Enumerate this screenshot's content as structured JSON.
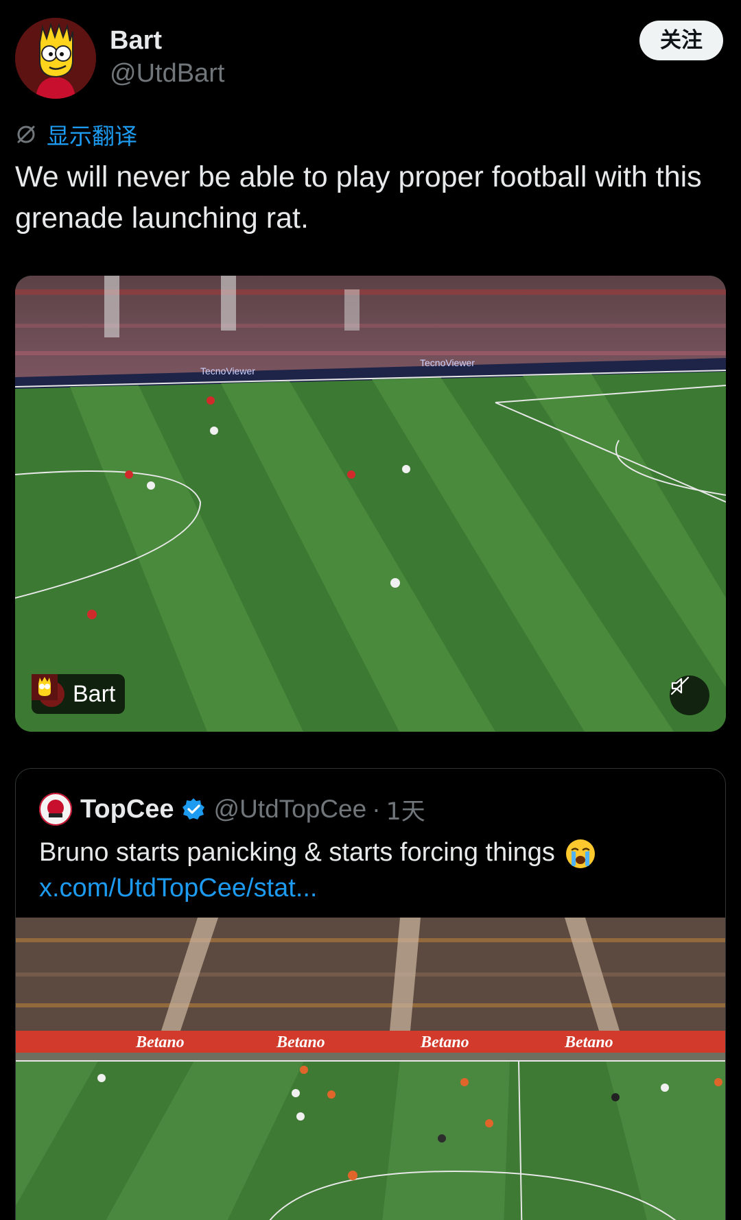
{
  "post": {
    "author_name": "Bart",
    "author_handle": "@UtdBart",
    "follow_label": "关注",
    "translate_label": "显示翻译",
    "text": "We will never be able to play proper football with this grenade launching rat."
  },
  "video": {
    "badge_label": "Bart",
    "board_text": "TecnoViewer"
  },
  "quote": {
    "author_name": "TopCee",
    "author_handle": "@UtdTopCee",
    "separator": "·",
    "time": "1天",
    "text": "Bruno starts panicking & starts forcing things",
    "link": "x.com/UtdTopCee/stat...",
    "board_text": "Betano"
  },
  "colors": {
    "link_blue": "#1d9bf0",
    "muted_gray": "#71767b",
    "verified_blue": "#1d9bf0"
  },
  "icons": [
    "translate-icon",
    "mute-icon",
    "verified-icon",
    "crying-emoji"
  ]
}
